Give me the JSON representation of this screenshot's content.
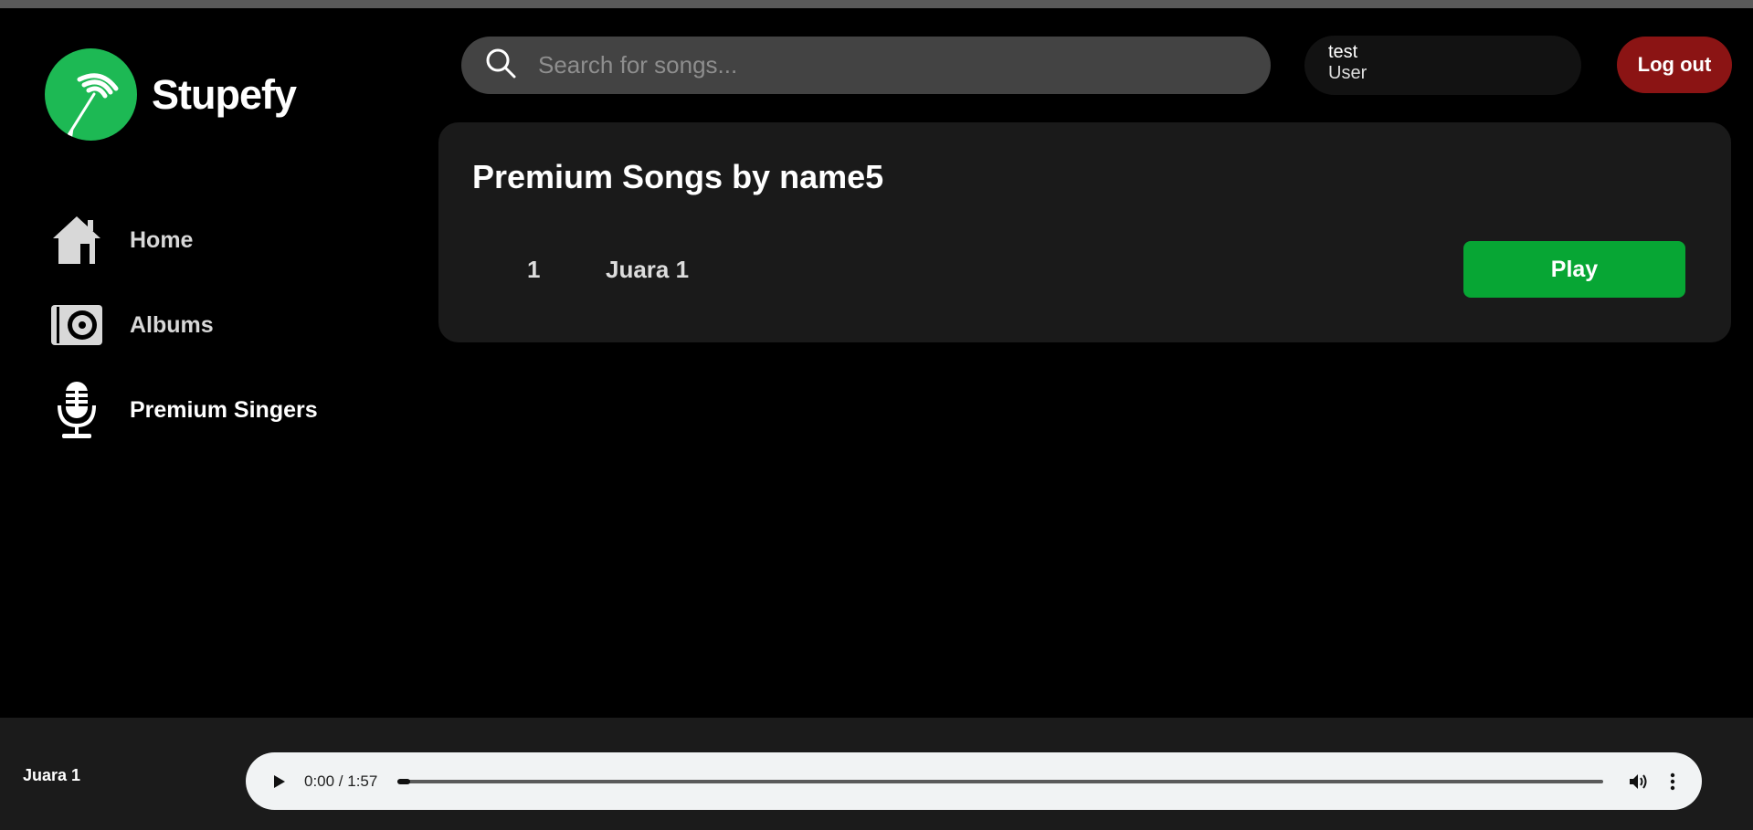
{
  "app": {
    "name": "Stupefy",
    "brand_color": "#1db954"
  },
  "sidebar": {
    "items": [
      {
        "label": "Home",
        "icon": "home-icon"
      },
      {
        "label": "Albums",
        "icon": "album-icon"
      },
      {
        "label": "Premium Singers",
        "icon": "microphone-icon",
        "active": true
      }
    ]
  },
  "header": {
    "search": {
      "placeholder": "Search for songs...",
      "value": ""
    },
    "user": {
      "name": "test",
      "role": "User"
    },
    "logout_label": "Log out",
    "logout_color": "#8b1414"
  },
  "main": {
    "title": "Premium Songs by name5",
    "songs": [
      {
        "number": "1",
        "title": "Juara 1",
        "action_label": "Play"
      }
    ],
    "play_color": "#07a634"
  },
  "player": {
    "now_playing": "Juara 1",
    "time": "0:00 / 1:57",
    "progress": 0
  }
}
